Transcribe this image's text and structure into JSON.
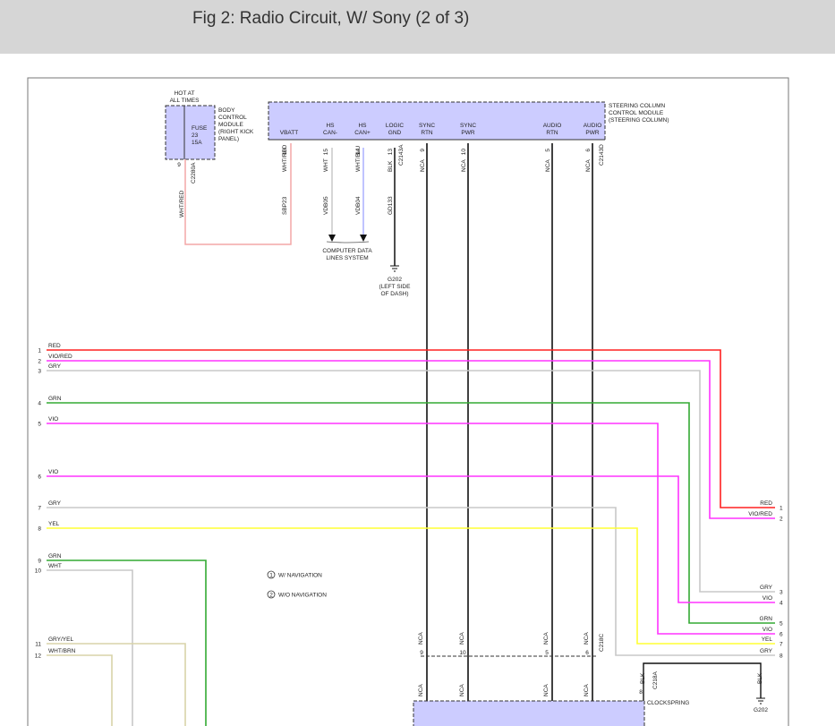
{
  "header": {
    "title": "Fig 2: Radio Circuit, W/ Sony (2 of 3)"
  },
  "bcm": {
    "hot": "HOT AT",
    "hot2": "ALL TIMES",
    "fuse": "FUSE",
    "fuse_num": "23",
    "fuse_amp": "15A",
    "label1": "BODY",
    "label2": "CONTROL",
    "label3": "MODULE",
    "label4": "(RIGHT KICK",
    "label5": "PANEL)",
    "pin": "9",
    "connector": "C2280A",
    "wire": "WHT/RED"
  },
  "sccm": {
    "label1": "STEERING COLUMN",
    "label2": "CONTROL MODULE",
    "label3": "(STEERING COLUMN)",
    "connector_a": "C2143A",
    "connector_b": "C2143D",
    "pins": [
      {
        "name1": "",
        "name2": "VBATT",
        "num": "10",
        "wire": "WHT/RED",
        "circuit": "SBP23"
      },
      {
        "name1": "HS",
        "name2": "CAN-",
        "num": "15",
        "wire": "WHT",
        "circuit": "VDB05"
      },
      {
        "name1": "HS",
        "name2": "CAN+",
        "num": "14",
        "wire": "WHT/BLU",
        "circuit": "VDB04"
      },
      {
        "name1": "LOGIC",
        "name2": "GND",
        "num": "13",
        "wire": "BLK",
        "circuit": "GD133"
      },
      {
        "name1": "SYNC",
        "name2": "RTN",
        "num": "9",
        "wire": "NCA",
        "circuit": ""
      },
      {
        "name1": "SYNC",
        "name2": "PWR",
        "num": "10",
        "wire": "NCA",
        "circuit": ""
      },
      {
        "name1": "AUDIO",
        "name2": "RTN",
        "num": "5",
        "wire": "NCA",
        "circuit": ""
      },
      {
        "name1": "AUDIO",
        "name2": "PWR",
        "num": "6",
        "wire": "NCA",
        "circuit": ""
      }
    ]
  },
  "cdl": {
    "line1": "COMPUTER DATA",
    "line2": "LINES SYSTEM"
  },
  "ground": {
    "name": "G202",
    "loc1": "(LEFT SIDE",
    "loc2": "OF DASH)"
  },
  "left_wires": [
    {
      "num": "1",
      "label": "RED"
    },
    {
      "num": "2",
      "label": "VIO/RED"
    },
    {
      "num": "3",
      "label": "GRY"
    },
    {
      "num": "4",
      "label": "GRN"
    },
    {
      "num": "5",
      "label": "VIO"
    },
    {
      "num": "6",
      "label": "VIO"
    },
    {
      "num": "7",
      "label": "GRY"
    },
    {
      "num": "8",
      "label": "YEL"
    },
    {
      "num": "9",
      "label": "GRN"
    },
    {
      "num": "10",
      "label": "WHT"
    },
    {
      "num": "11",
      "label": "GRY/YEL"
    },
    {
      "num": "12",
      "label": "WHT/BRN"
    }
  ],
  "right_wires": [
    {
      "num": "1",
      "label": "RED"
    },
    {
      "num": "2",
      "label": "VIO/RED"
    },
    {
      "num": "3",
      "label": "GRY"
    },
    {
      "num": "4",
      "label": "VIO"
    },
    {
      "num": "5",
      "label": "GRN"
    },
    {
      "num": "6",
      "label": "VIO"
    },
    {
      "num": "7",
      "label": "YEL"
    },
    {
      "num": "8",
      "label": "GRY"
    }
  ],
  "legend": [
    {
      "num": "1",
      "text": "W/ NAVIGATION"
    },
    {
      "num": "2",
      "text": "W/O NAVIGATION"
    }
  ],
  "lower": {
    "connector": "C218C",
    "nums": [
      "9",
      "10",
      "5",
      "6"
    ],
    "wire": "NCA",
    "blk_pin": "8",
    "blk_conn": "C218A",
    "blk": "BLK",
    "clockspring": "CLOCKSPRING",
    "ground": "G202"
  },
  "colors": {
    "red": "#ff2020",
    "violet": "#ff33ff",
    "gray": "#c8c8c8",
    "green": "#33aa33",
    "yellow": "#ffff33",
    "pink_wire": "#f4a7a7",
    "tan": "#d8d3a8",
    "module_fill": "#ccccff"
  }
}
